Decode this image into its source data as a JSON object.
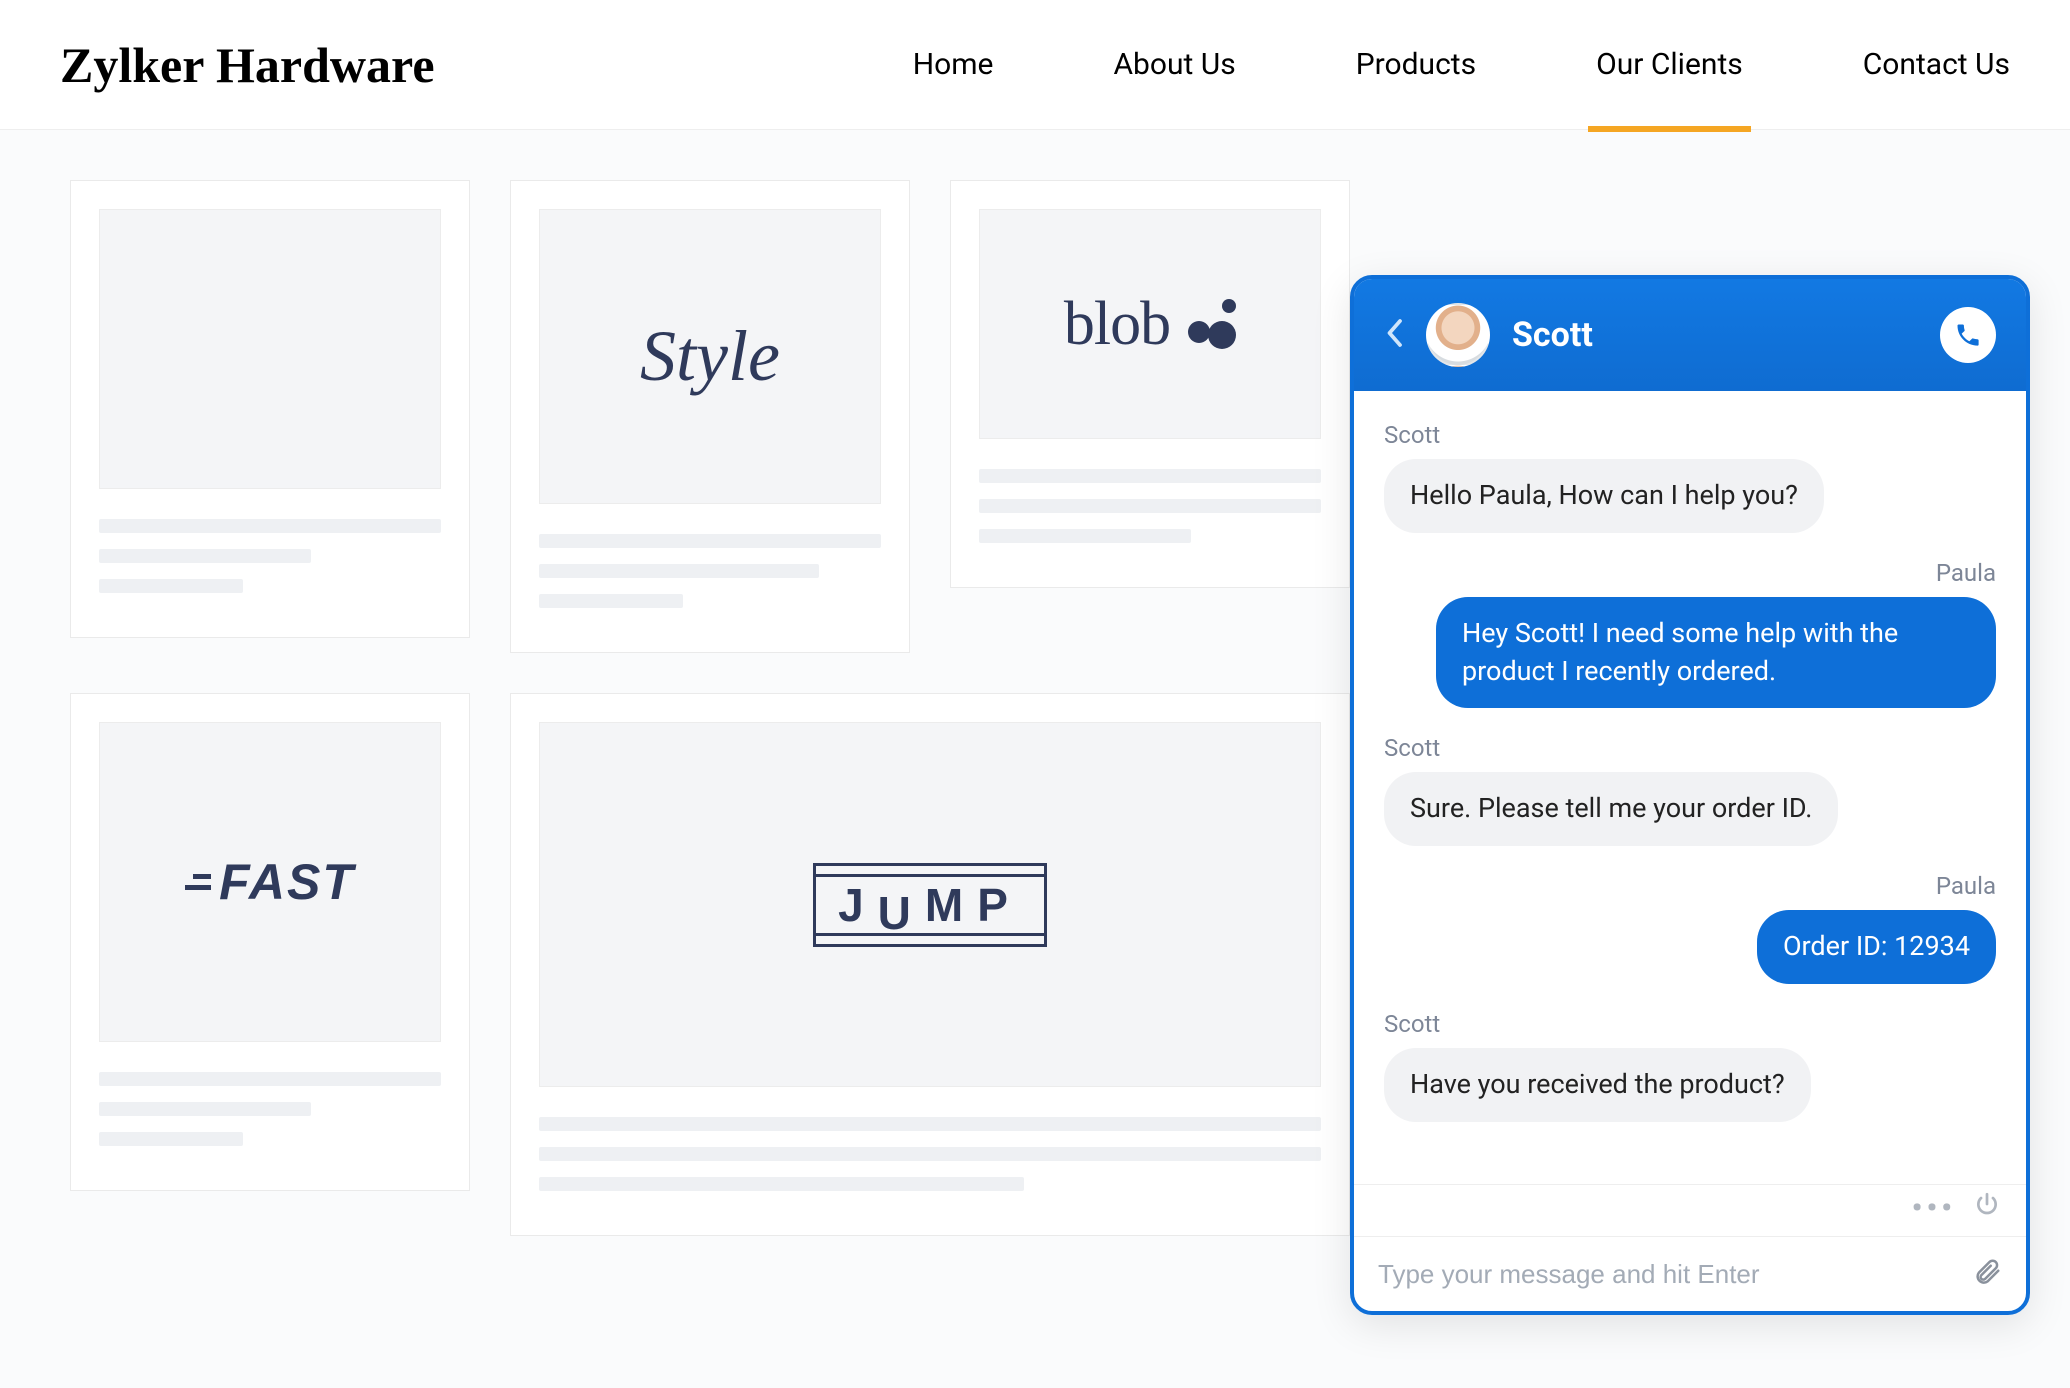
{
  "brand": "Zylker Hardware",
  "nav": {
    "items": [
      {
        "label": "Home",
        "active": false
      },
      {
        "label": "About Us",
        "active": false
      },
      {
        "label": "Products",
        "active": false
      },
      {
        "label": "Our Clients",
        "active": true
      },
      {
        "label": "Contact Us",
        "active": false
      }
    ]
  },
  "clients": {
    "style": "Style",
    "blob": "blob",
    "fast": "FAST",
    "jump": "JUMP"
  },
  "chat": {
    "agent_name": "Scott",
    "messages": [
      {
        "sender": "Scott",
        "side": "left",
        "text": "Hello Paula, How can I help you?"
      },
      {
        "sender": "Paula",
        "side": "right",
        "text": "Hey Scott! I need some help with the product I recently ordered."
      },
      {
        "sender": "Scott",
        "side": "left",
        "text": "Sure. Please tell me your order ID."
      },
      {
        "sender": "Paula",
        "side": "right",
        "text": "Order ID: 12934"
      },
      {
        "sender": "Scott",
        "side": "left",
        "text": "Have you received the product?"
      }
    ],
    "input_placeholder": "Type your message and hit Enter"
  },
  "colors": {
    "accent": "#0e6fd8",
    "nav_active_underline": "#f5a623",
    "logo_navy": "#2f3a5b"
  }
}
